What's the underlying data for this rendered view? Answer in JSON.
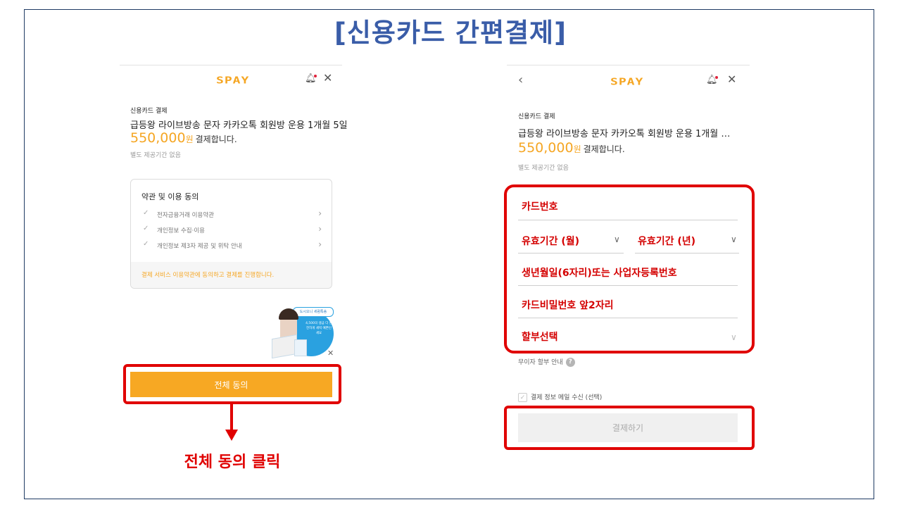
{
  "slide": {
    "title": "[신용카드 간편결제]"
  },
  "left": {
    "logo": "SPAY",
    "section_label": "신용카드 결제",
    "product_title": "급등왕 라이브방송 문자 카카오톡 회원방 운용 1개월 5일",
    "amount": "550,000",
    "amount_unit": "원",
    "amount_suffix": "결제합니다.",
    "note": "별도 제공기간 없음",
    "agreement": {
      "title": "약관 및 이용 동의",
      "items": [
        {
          "label": "전자금융거래 이용약관"
        },
        {
          "label": "개인정보 수집·이용"
        },
        {
          "label": "개인정보 제3자 제공 및 위탁 안내"
        }
      ],
      "footer": "결제 서비스 이용약관에 동의하고 결제를 진행합니다."
    },
    "ad": {
      "tag": "도시오니 세럼특송",
      "text": "4,500의 생금 다 완전하게 세럭 예쁜신세요"
    },
    "agree_all_button": "전체 동의",
    "caption": "전체 동의 클릭"
  },
  "right": {
    "logo": "SPAY",
    "section_label": "신용카드 결제",
    "product_title": "급등왕 라이브방송 문자 카카오톡 회원방 운용 1개월 …",
    "amount": "550,000",
    "amount_unit": "원",
    "amount_suffix": "결제합니다.",
    "note": "별도 제공기간 없음",
    "fields": {
      "card_number": "카드번호",
      "expiry_month": "유효기간 (월)",
      "expiry_year": "유효기간 (년)",
      "birth_or_biz": "생년월일(6자리)또는 사업자등록번호",
      "card_password": "카드비밀번호 앞2자리",
      "installment": "할부선택"
    },
    "interest_free_info": "무이자 할부 안내",
    "mail_opt_in": "결제 정보 메일 수신 (선택)",
    "pay_button": "결제하기"
  },
  "colors": {
    "accent": "#f7a823",
    "highlight": "#e00000",
    "title": "#3a5da8"
  }
}
